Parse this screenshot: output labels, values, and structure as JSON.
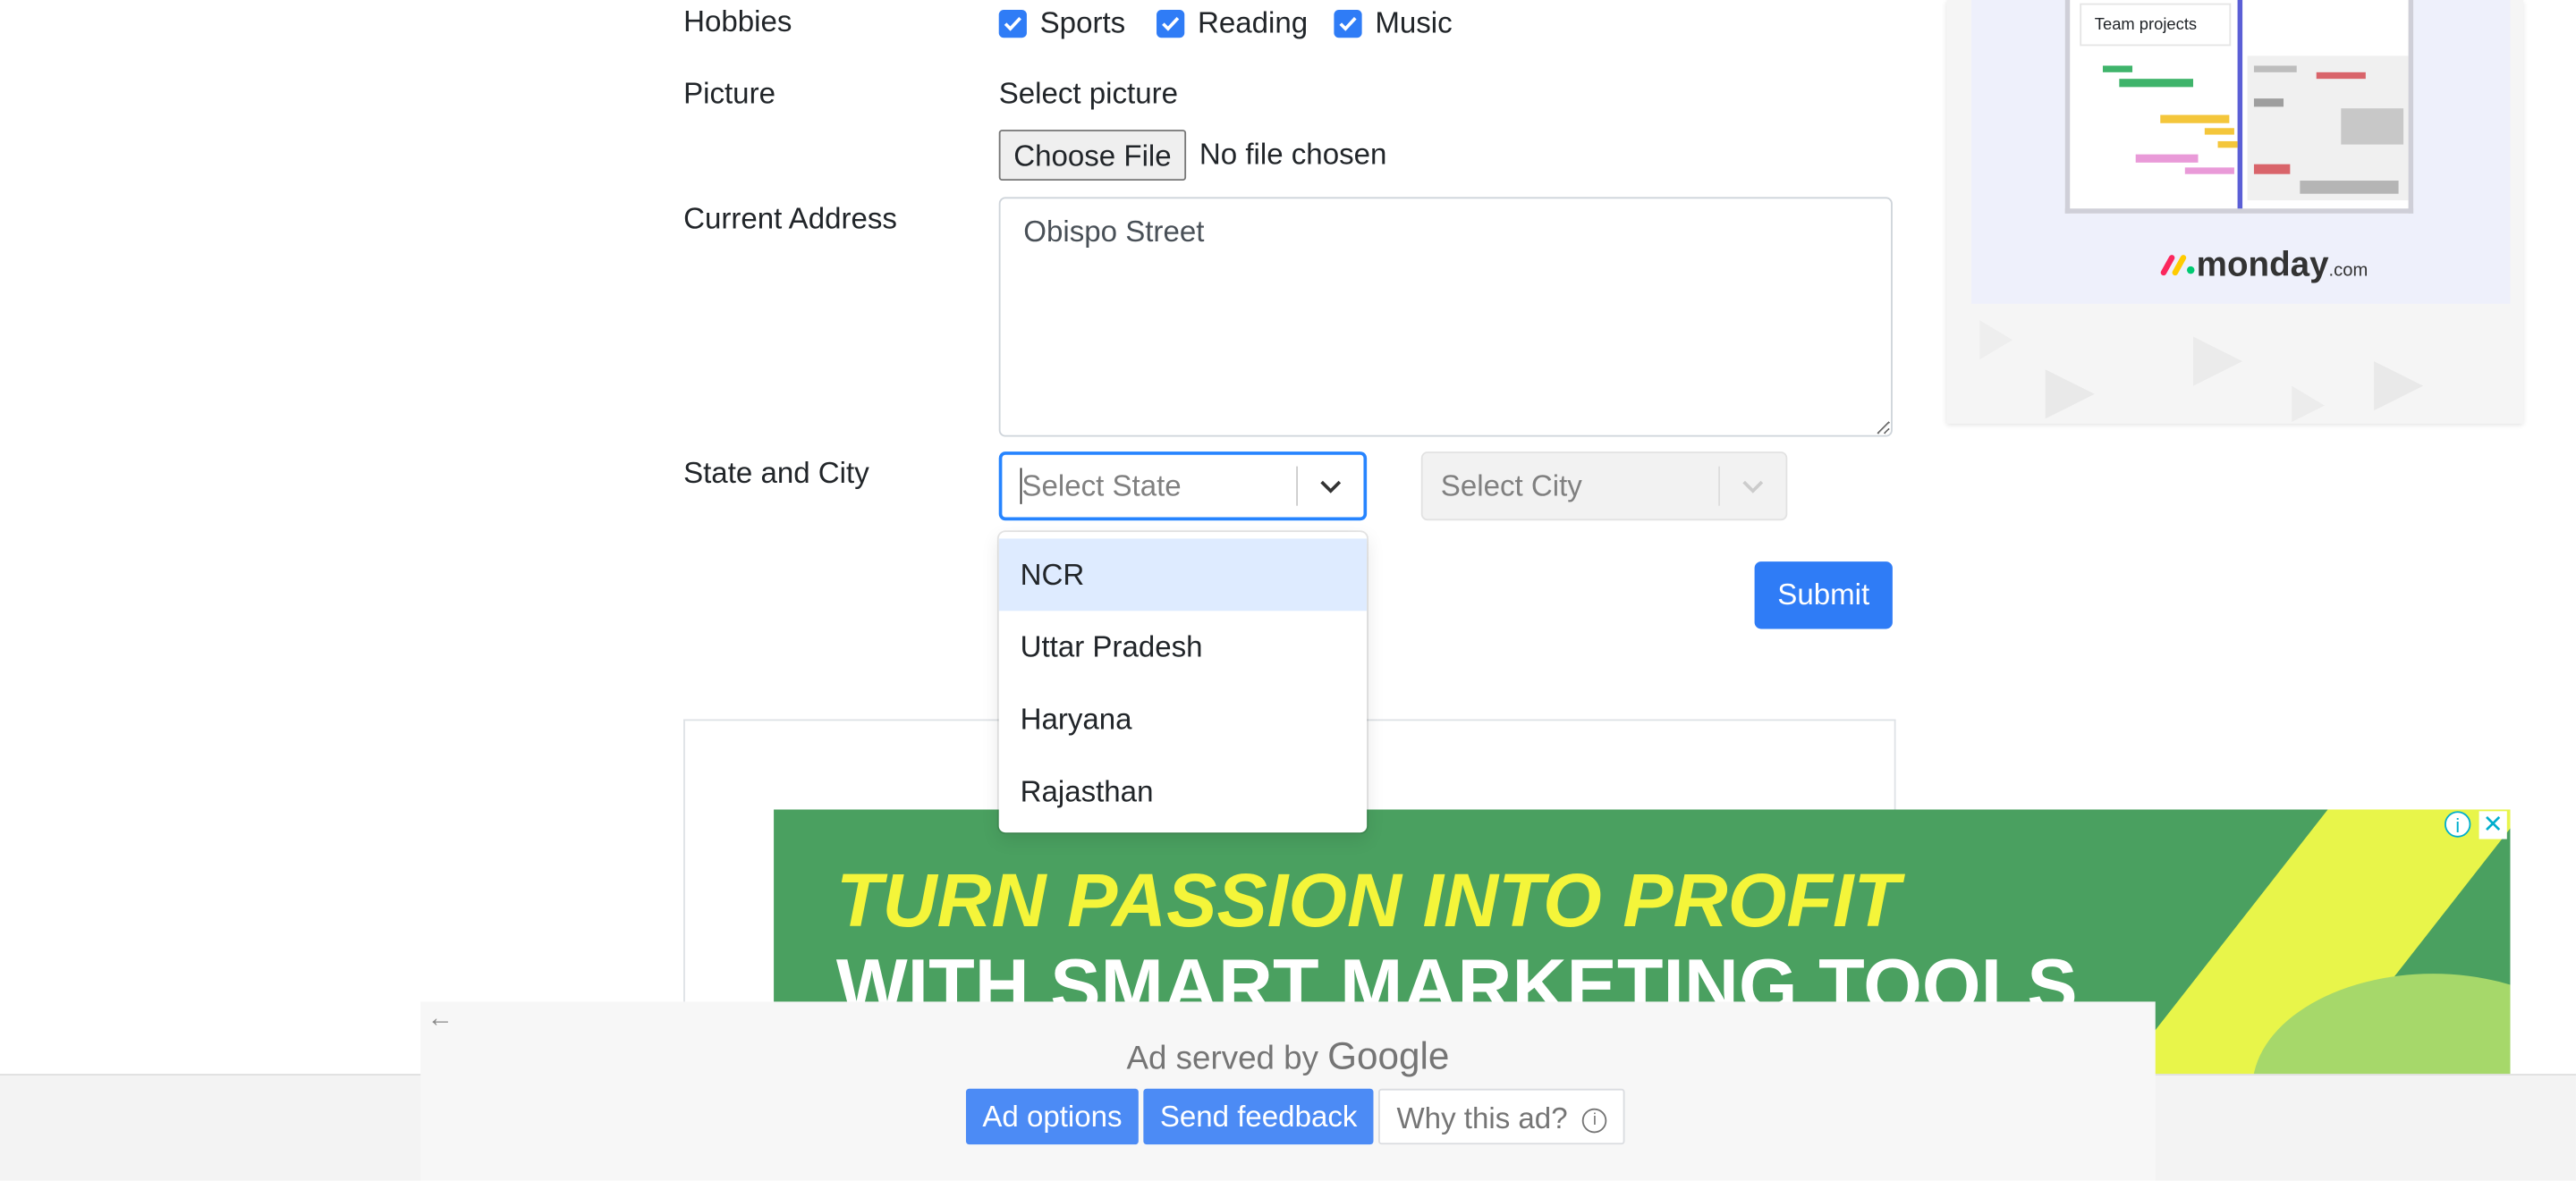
{
  "form": {
    "hobbies_label": "Hobbies",
    "hobbies": [
      {
        "label": "Sports",
        "checked": true
      },
      {
        "label": "Reading",
        "checked": true
      },
      {
        "label": "Music",
        "checked": true
      }
    ],
    "picture_label": "Picture",
    "select_picture": "Select picture",
    "choose_file": "Choose File",
    "no_file": "No file chosen",
    "address_label": "Current Address",
    "address_value": "Obispo Street",
    "state_city_label": "State and City",
    "state_placeholder": "Select State",
    "city_placeholder": "Select City",
    "state_options": [
      "NCR",
      "Uttar Pradesh",
      "Haryana",
      "Rajasthan"
    ],
    "submit": "Submit"
  },
  "side_ad": {
    "card_title": "Team projects",
    "brand": "monday",
    "brand_suffix": ".com"
  },
  "bottom_ad": {
    "headline_1": "TURN PASSION INTO PROFIT",
    "headline_2": "WITH SMART MARKETING TOOLS",
    "served_by": "Ad served by",
    "google": "Google",
    "ad_options": "Ad options",
    "send_feedback": "Send feedback",
    "why_this_ad": "Why this ad?"
  },
  "colors": {
    "accent": "#2f7cf6",
    "ad_green": "#4aa060",
    "headline_yellow": "#f4f53a",
    "highlight": "#deebff"
  }
}
